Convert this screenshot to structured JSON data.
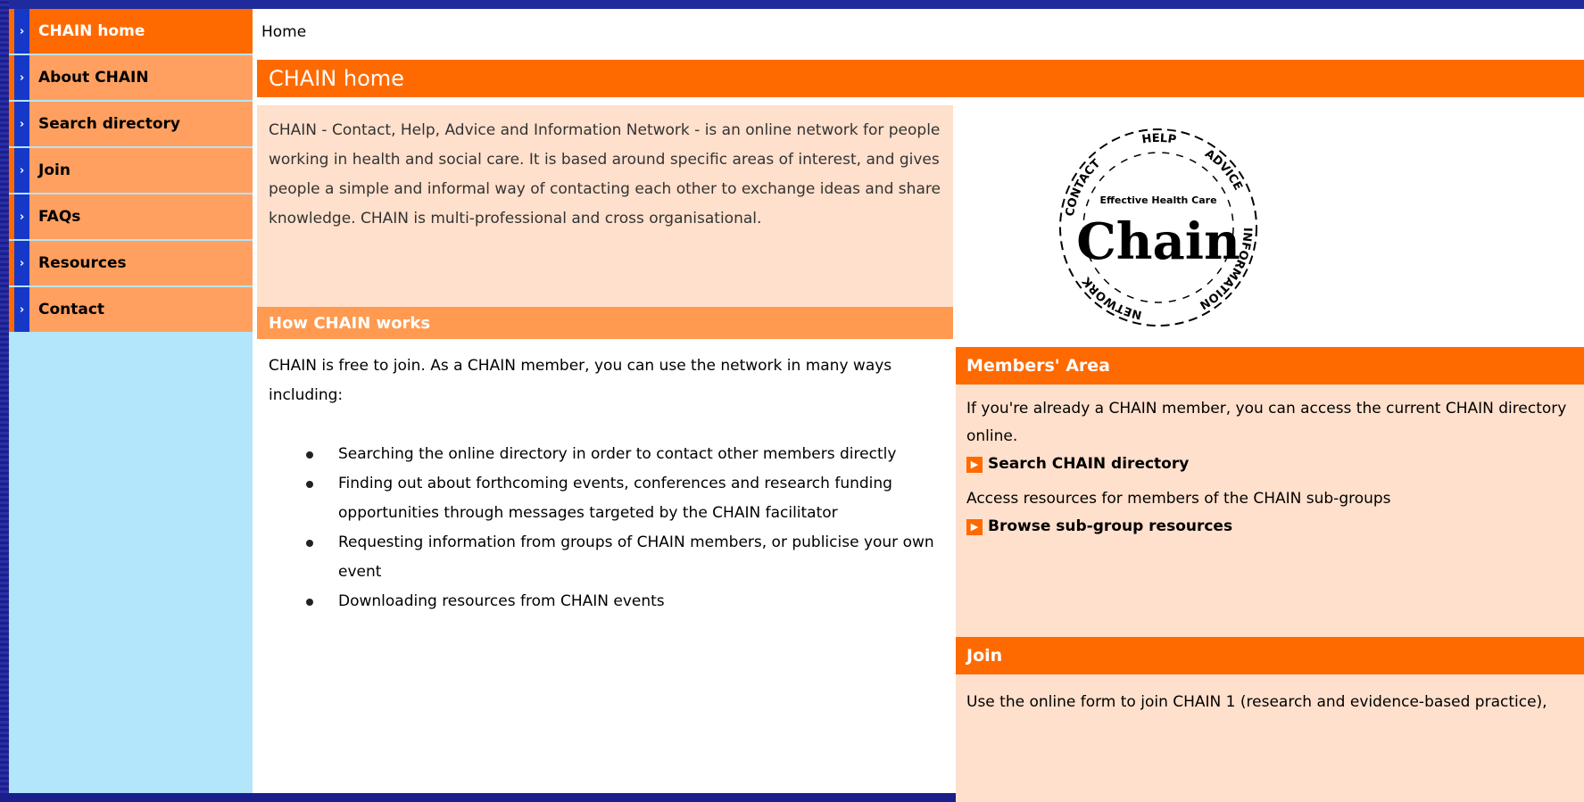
{
  "nav": {
    "items": [
      {
        "label": "CHAIN home",
        "active": true
      },
      {
        "label": "About CHAIN"
      },
      {
        "label": "Search directory"
      },
      {
        "label": "Join"
      },
      {
        "label": "FAQs"
      },
      {
        "label": "Resources"
      },
      {
        "label": "Contact"
      }
    ]
  },
  "breadcrumb": "Home",
  "page_title": "CHAIN home",
  "intro": {
    "text": "CHAIN - Contact, Help, Advice and Information Network - is an online network for people working in health and social care. It is based around specific areas of interest, and gives people a simple and informal way of contacting each other to exchange ideas and share knowledge.  CHAIN is multi-professional and cross organisational."
  },
  "how_it_works": {
    "title": "How CHAIN works",
    "intro": "CHAIN is free to join. As a CHAIN member, you can use the network in many ways including:",
    "bullets": [
      "Searching the online directory in order to contact other members directly",
      "Finding out about forthcoming events, conferences and research funding opportunities through messages targeted by the CHAIN facilitator",
      "Requesting information from groups of CHAIN members, or publicise your own event",
      "Downloading resources from CHAIN events"
    ]
  },
  "logo": {
    "words": [
      "CONTACT",
      "HELP",
      "ADVICE",
      "INFORMATION",
      "NETWORK"
    ],
    "tagline": "Effective Health Care",
    "wordmark": "Chain"
  },
  "members_area": {
    "title": "Members' Area",
    "text1": "If you're already a CHAIN member, you can access the current CHAIN directory online.",
    "link1": "Search CHAIN directory",
    "text2": "Access resources for members of the CHAIN sub-groups",
    "link2": "Browse sub-group resources"
  },
  "join": {
    "title": "Join",
    "text": "Use the online form to join CHAIN 1 (research and evidence-based practice),"
  },
  "colors": {
    "accent": "#ff6a00",
    "nav_bg": "#ffa060",
    "panel_bg": "#ffe0cc",
    "sidebar_bg": "#b3e5fb",
    "frame": "#1a1f8c"
  }
}
